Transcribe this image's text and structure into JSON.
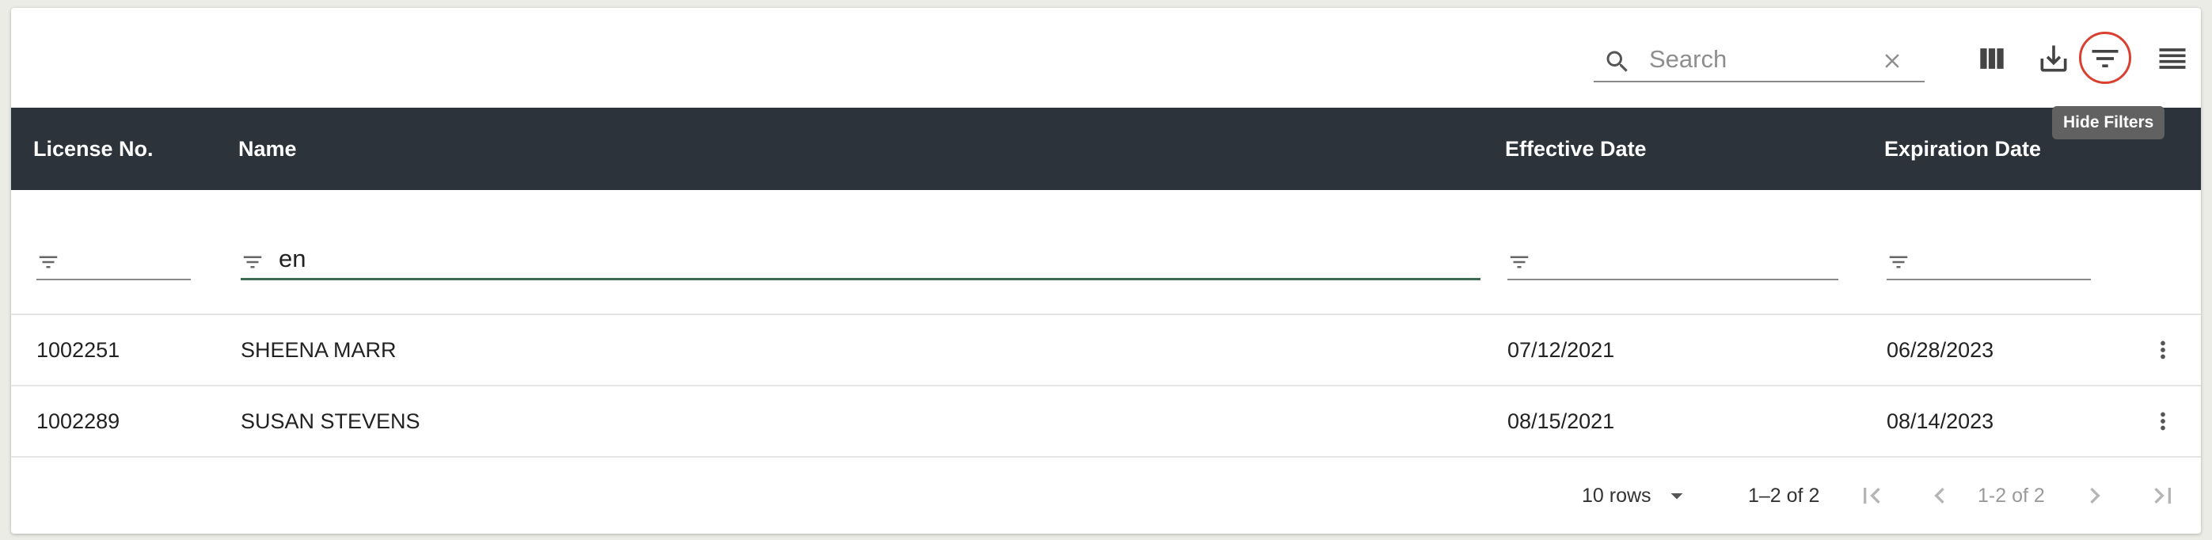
{
  "toolbar": {
    "search": {
      "placeholder": "Search",
      "value": ""
    },
    "buttons": [
      "columns-icon",
      "download-icon",
      "filter-icon",
      "view-list-icon"
    ],
    "tooltip": "Hide Filters",
    "accent_color": "#d9402f"
  },
  "table": {
    "header_bg": "#2c333b",
    "columns": [
      "License No.",
      "Name",
      "Effective Date",
      "Expiration Date"
    ],
    "filters": [
      "",
      "en",
      "",
      ""
    ],
    "rows": [
      {
        "license": "1002251",
        "name": "SHEENA MARR",
        "effective": "07/12/2021",
        "expiration": "06/28/2023"
      },
      {
        "license": "1002289",
        "name": "SUSAN STEVENS",
        "effective": "08/15/2021",
        "expiration": "08/14/2023"
      }
    ]
  },
  "footer": {
    "rows_per_page": "10 rows",
    "range": "1–2 of 2",
    "page_label": "1-2 of 2"
  }
}
